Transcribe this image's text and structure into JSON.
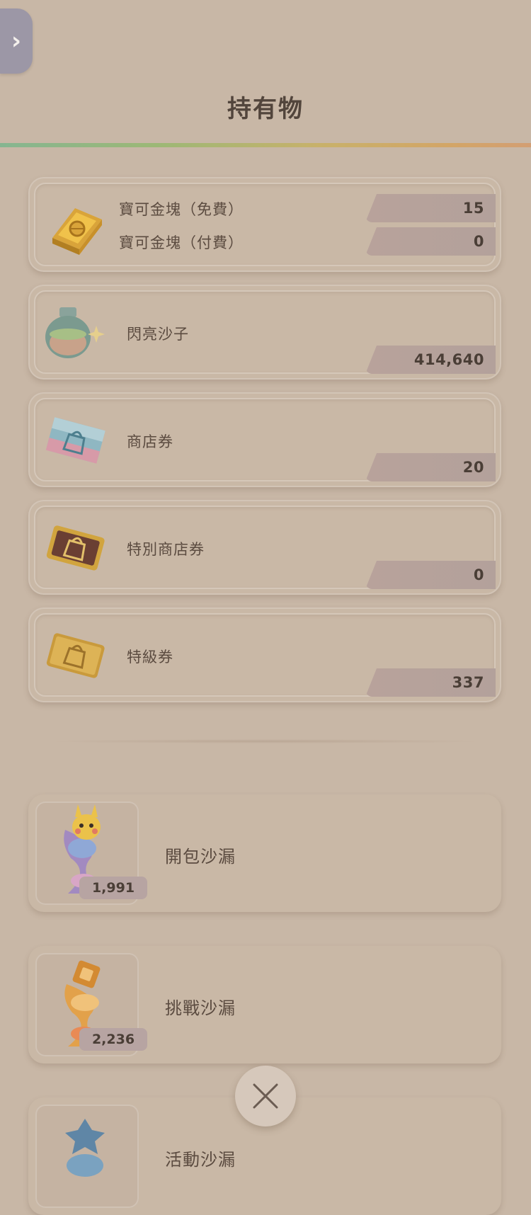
{
  "header": {
    "back_icon": "chevron-right-icon",
    "back_glyph": "›",
    "title": "持有物"
  },
  "currencies": {
    "gold": {
      "icon": "gold-bar-icon",
      "free_label": "寶可金塊（免費）",
      "free_value": "15",
      "paid_label": "寶可金塊（付費）",
      "paid_value": "0"
    },
    "sand": {
      "icon": "sand-bottle-icon",
      "label": "閃亮沙子",
      "value": "414,640"
    },
    "shop_ticket": {
      "icon": "shop-ticket-icon",
      "label": "商店券",
      "value": "20"
    },
    "special_shop_ticket": {
      "icon": "special-shop-ticket-icon",
      "label": "特別商店券",
      "value": "0"
    },
    "premium_ticket": {
      "icon": "premium-ticket-icon",
      "label": "特級券",
      "value": "337"
    }
  },
  "hourglasses": [
    {
      "icon": "pack-hourglass-icon",
      "label": "開包沙漏",
      "count": "1,991"
    },
    {
      "icon": "challenge-hourglass-icon",
      "label": "挑戰沙漏",
      "count": "2,236"
    },
    {
      "icon": "event-hourglass-icon",
      "label": "活動沙漏"
    }
  ],
  "close_icon": "close-icon"
}
